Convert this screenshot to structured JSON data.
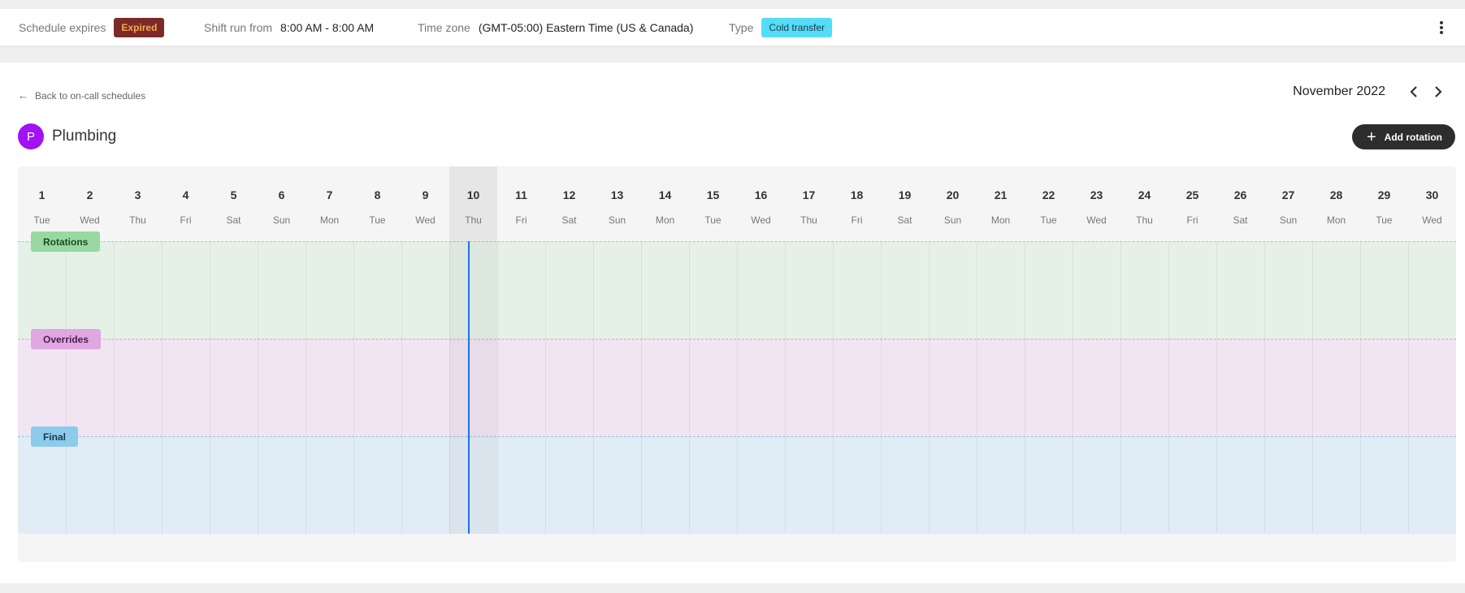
{
  "summary": {
    "expires_label": "Schedule expires",
    "expires_badge": "Expired",
    "shift_label": "Shift run from",
    "shift_value": "8:00 AM - 8:00 AM",
    "timezone_label": "Time zone",
    "timezone_value": "(GMT-05:00) Eastern Time (US & Canada)",
    "type_label": "Type",
    "type_badge": "Cold transfer"
  },
  "nav": {
    "back_label": "Back to on-call schedules",
    "month_label": "November 2022"
  },
  "schedule": {
    "avatar_letter": "P",
    "title": "Plumbing",
    "add_label": "Add rotation"
  },
  "calendar": {
    "today_index": 9,
    "days": [
      {
        "num": "1",
        "name": "Tue"
      },
      {
        "num": "2",
        "name": "Wed"
      },
      {
        "num": "3",
        "name": "Thu"
      },
      {
        "num": "4",
        "name": "Fri"
      },
      {
        "num": "5",
        "name": "Sat"
      },
      {
        "num": "6",
        "name": "Sun"
      },
      {
        "num": "7",
        "name": "Mon"
      },
      {
        "num": "8",
        "name": "Tue"
      },
      {
        "num": "9",
        "name": "Wed"
      },
      {
        "num": "10",
        "name": "Thu"
      },
      {
        "num": "11",
        "name": "Fri"
      },
      {
        "num": "12",
        "name": "Sat"
      },
      {
        "num": "13",
        "name": "Sun"
      },
      {
        "num": "14",
        "name": "Mon"
      },
      {
        "num": "15",
        "name": "Tue"
      },
      {
        "num": "16",
        "name": "Wed"
      },
      {
        "num": "17",
        "name": "Thu"
      },
      {
        "num": "18",
        "name": "Fri"
      },
      {
        "num": "19",
        "name": "Sat"
      },
      {
        "num": "20",
        "name": "Sun"
      },
      {
        "num": "21",
        "name": "Mon"
      },
      {
        "num": "22",
        "name": "Tue"
      },
      {
        "num": "23",
        "name": "Wed"
      },
      {
        "num": "24",
        "name": "Thu"
      },
      {
        "num": "25",
        "name": "Fri"
      },
      {
        "num": "26",
        "name": "Sat"
      },
      {
        "num": "27",
        "name": "Sun"
      },
      {
        "num": "28",
        "name": "Mon"
      },
      {
        "num": "29",
        "name": "Tue"
      },
      {
        "num": "30",
        "name": "Wed"
      }
    ],
    "rows": {
      "rotations": "Rotations",
      "overrides": "Overrides",
      "final": "Final"
    }
  },
  "colors": {
    "accent": "#1a73e8",
    "avatar": "#a112f4",
    "expired_bg": "#7b2a2a",
    "type_bg": "#55dcf7"
  }
}
